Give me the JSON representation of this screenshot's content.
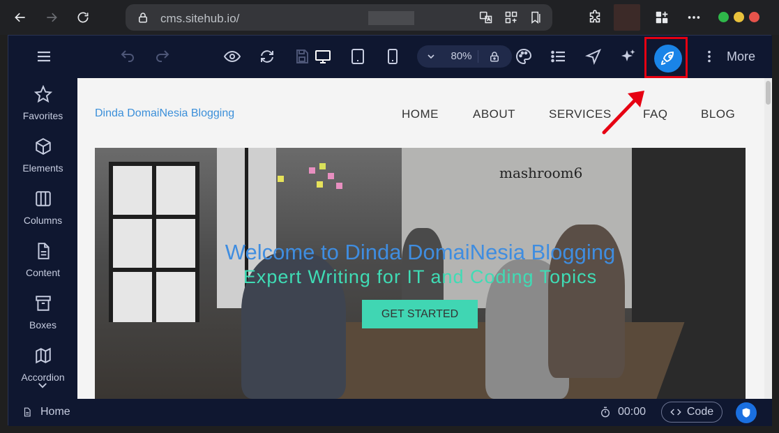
{
  "browser": {
    "url": "cms.sitehub.io/"
  },
  "toolbar": {
    "zoom": "80%",
    "more_label": "More"
  },
  "sidebar": {
    "items": [
      {
        "label": "Favorites",
        "icon": "star-icon"
      },
      {
        "label": "Elements",
        "icon": "cube-icon"
      },
      {
        "label": "Columns",
        "icon": "columns-icon"
      },
      {
        "label": "Content",
        "icon": "document-icon"
      },
      {
        "label": "Boxes",
        "icon": "archive-box-icon"
      },
      {
        "label": "Accordion",
        "icon": "map-icon"
      }
    ]
  },
  "site": {
    "brand": "Dinda DomaiNesia Blogging",
    "nav": [
      "HOME",
      "ABOUT",
      "SERVICES",
      "FAQ",
      "BLOG"
    ],
    "hero_title": "Welcome to Dinda DomaiNesia Blogging",
    "hero_subtitle": "Expert Writing for IT and Coding Topics",
    "cta_label": "GET STARTED",
    "photo_sign": "mashroom6"
  },
  "status": {
    "page": "Home",
    "timer": "00:00",
    "code_label": "Code"
  },
  "colors": {
    "accent": "#1a84e8",
    "highlight": "#e60012",
    "app_bg": "#0f1730",
    "hero_title": "#3f8de0",
    "hero_subtitle": "#3fdcb5",
    "cta_bg": "#40d6b3"
  }
}
